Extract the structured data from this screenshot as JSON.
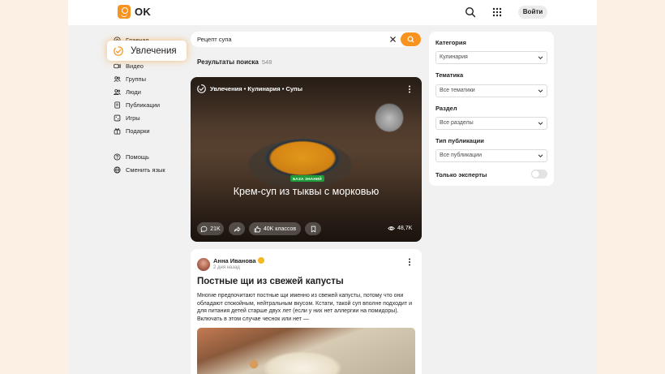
{
  "header": {
    "logo_text": "OK",
    "login_label": "Войти",
    "icons": [
      "search-icon",
      "apps-grid-icon"
    ]
  },
  "nav": {
    "items": [
      {
        "label": "Главная",
        "icon": "home-icon"
      },
      {
        "label": "Видео",
        "icon": "video-icon"
      },
      {
        "label": "Группы",
        "icon": "groups-icon"
      },
      {
        "label": "Люди",
        "icon": "people-icon"
      },
      {
        "label": "Публикации",
        "icon": "publications-icon"
      },
      {
        "label": "Игры",
        "icon": "games-icon"
      },
      {
        "label": "Подарки",
        "icon": "gift-icon"
      }
    ],
    "secondary": [
      {
        "label": "Помощь",
        "icon": "help-icon"
      },
      {
        "label": "Сменить язык",
        "icon": "globe-icon"
      }
    ],
    "highlight_label": "Увлечения",
    "highlight_icon": "hobbies-icon"
  },
  "search": {
    "value": "Рецепт супа"
  },
  "results": {
    "title": "Результаты поиска",
    "count": "548"
  },
  "featured_card": {
    "breadcrumb": "Увлечения • Кулинария • Супы",
    "badge": "БАЗА ЗНАНИЙ",
    "title": "Крем-суп из тыквы с морковью",
    "comments": "21K",
    "likes": "40K классов",
    "views": "48,7K"
  },
  "post": {
    "author": "Анна Иванова",
    "time": "2 дня назад",
    "title": "Постные щи из свежей капусты",
    "text": "Многие предпочитают постные щи именно из свежей капусты, потому что они обладают спокойным, нейтральным вкусом. Кстати, такой суп вполне подходит и для питания детей старше двух лет (если у них нет аллергии на помидоры). Включать в этом случае чеснок или нет —"
  },
  "filters": {
    "category_label": "Категория",
    "category_value": "Кулинария",
    "topic_label": "Тематика",
    "topic_value": "Все тематики",
    "section_label": "Раздел",
    "section_value": "Все разделы",
    "pub_type_label": "Тип публикации",
    "pub_type_value": "Все публикации",
    "experts_label": "Только эксперты",
    "experts_only": false
  },
  "colors": {
    "accent": "#f7931e",
    "badge_green": "#1f9d3a",
    "page_bg": "#fcefe3"
  }
}
